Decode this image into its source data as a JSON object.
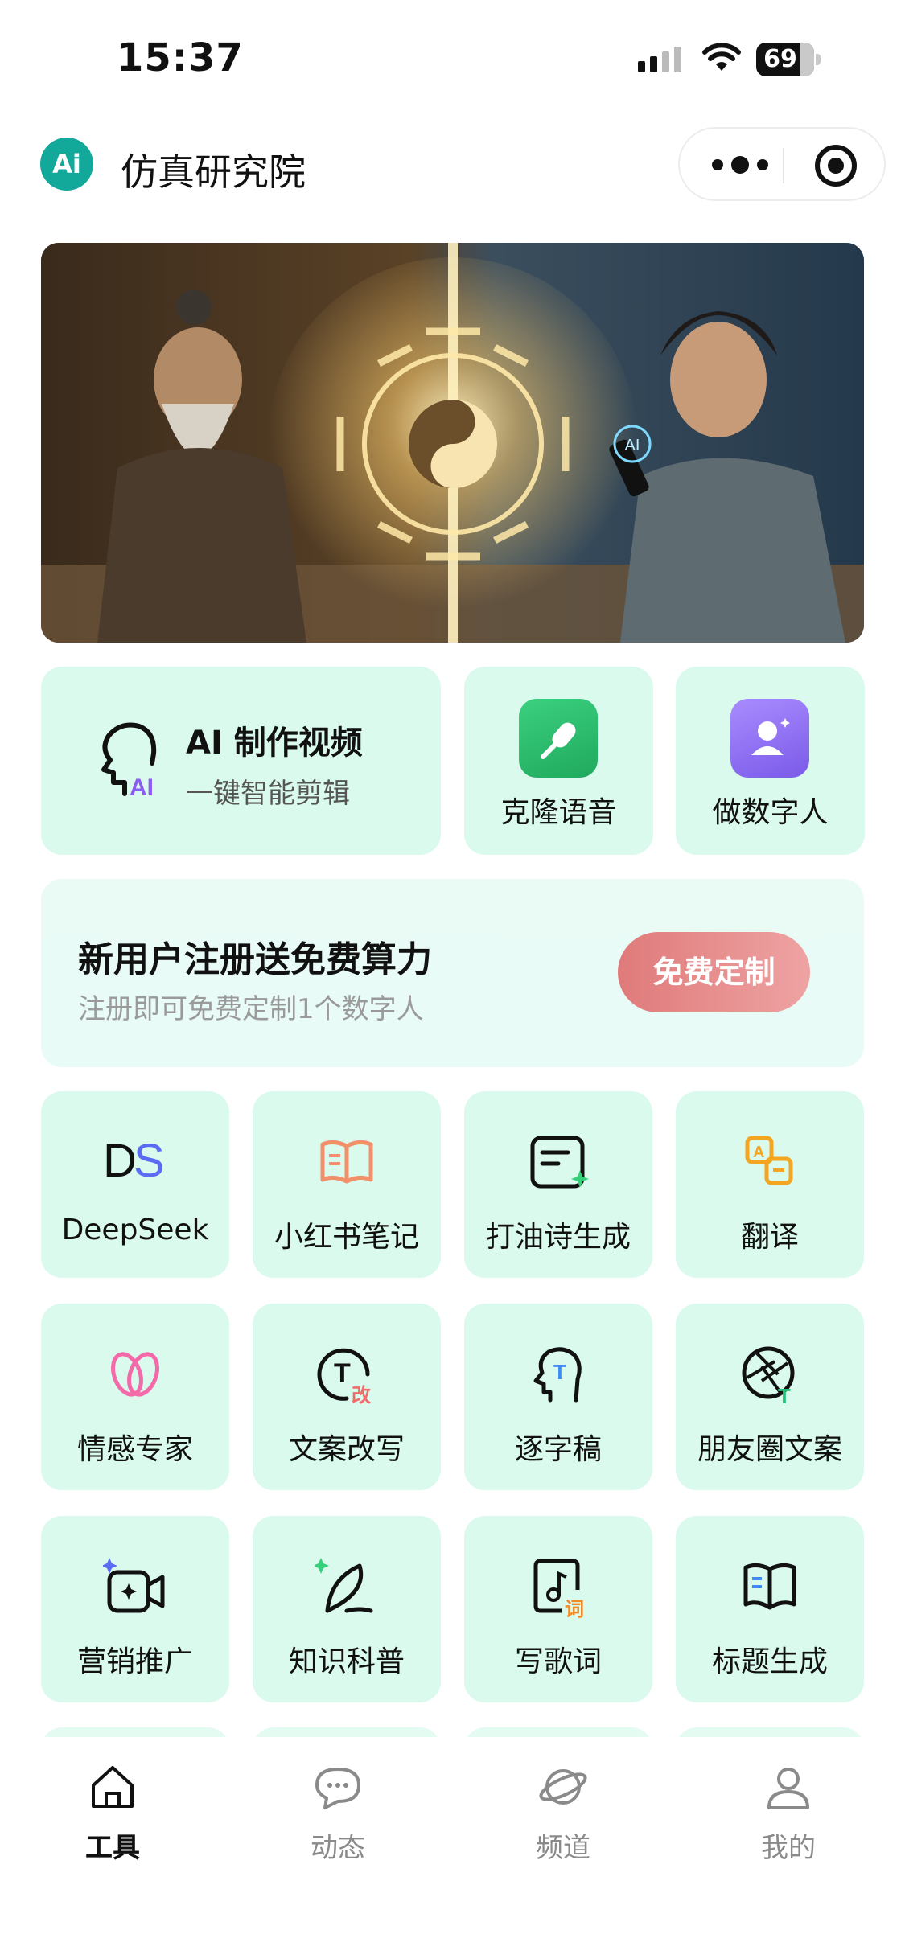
{
  "status_bar": {
    "time": "15:37",
    "battery": "69"
  },
  "header": {
    "logo_text": "Ai",
    "title": "仿真研究院"
  },
  "banner": {
    "badge_text": "AI"
  },
  "features": {
    "video": {
      "title": "AI 制作视频",
      "subtitle": "一键智能剪辑",
      "icon_text": "AI"
    },
    "voice": {
      "label": "克隆语音",
      "color": "#2fbf6f"
    },
    "avatar": {
      "label": "做数字人",
      "color": "#8a6cf3"
    }
  },
  "promo": {
    "title": "新用户注册送免费算力",
    "subtitle": "注册即可免费定制1个数字人",
    "button": "免费定制"
  },
  "tools": [
    {
      "label": "DeepSeek",
      "icon": "deepseek-icon"
    },
    {
      "label": "小红书笔记",
      "icon": "book-icon"
    },
    {
      "label": "打油诗生成",
      "icon": "poem-icon"
    },
    {
      "label": "翻译",
      "icon": "translate-icon"
    },
    {
      "label": "情感专家",
      "icon": "heart-icon"
    },
    {
      "label": "文案改写",
      "icon": "rewrite-icon"
    },
    {
      "label": "逐字稿",
      "icon": "transcript-icon"
    },
    {
      "label": "朋友圈文案",
      "icon": "camera-shutter-icon"
    },
    {
      "label": "营销推广",
      "icon": "video-camera-icon"
    },
    {
      "label": "知识科普",
      "icon": "feather-icon"
    },
    {
      "label": "写歌词",
      "icon": "music-note-icon"
    },
    {
      "label": "标题生成",
      "icon": "open-book-icon"
    }
  ],
  "icon_badges": {
    "rewrite": "改",
    "lyrics": "词",
    "transcript": "T"
  },
  "tabbar": [
    {
      "label": "工具",
      "icon": "house-icon",
      "active": true
    },
    {
      "label": "动态",
      "icon": "chat-bubble-icon",
      "active": false
    },
    {
      "label": "频道",
      "icon": "planet-icon",
      "active": false
    },
    {
      "label": "我的",
      "icon": "user-icon",
      "active": false
    }
  ]
}
